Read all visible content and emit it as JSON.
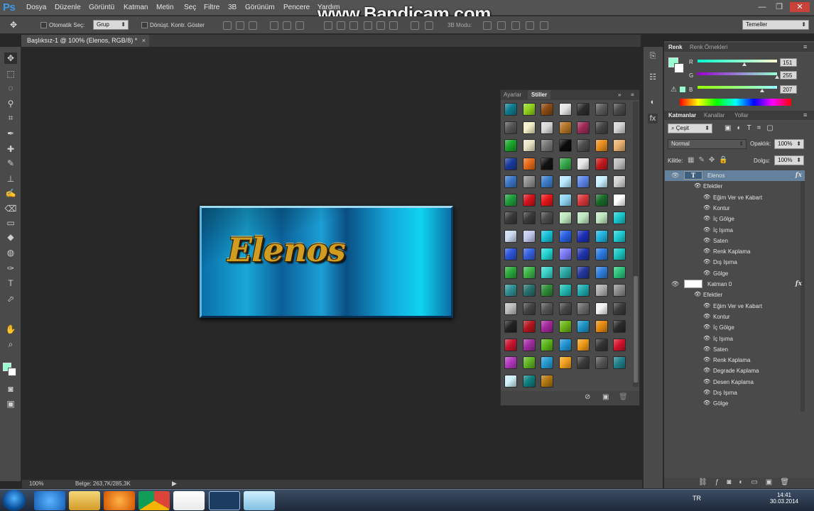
{
  "app": {
    "logo": "Ps",
    "watermark": "www.Bandicam.com"
  },
  "menu": [
    "Dosya",
    "Düzenle",
    "Görüntü",
    "Katman",
    "Metin",
    "Seç",
    "Filtre",
    "3B",
    "Görünüm",
    "Pencere",
    "Yardım"
  ],
  "window_controls": {
    "minimize": "—",
    "restore": "❐",
    "close": "✕"
  },
  "options": {
    "auto_select_label": "Otomatik Seç:",
    "auto_select_value": "Grup",
    "transform_label": "Dönüşt. Kontr. Göster",
    "mode3d_label": "3B Modu:",
    "workspace_value": "Temeller"
  },
  "document": {
    "tab_title": "Başlıksız-1 @ 100% (Elenos, RGB/8) *",
    "close": "×",
    "text": "Elenos"
  },
  "statusbar": {
    "zoom": "100%",
    "doc_info": "Belge: 263,7K/285,3K"
  },
  "styles_panel": {
    "tabs": [
      "Ayarlar",
      "Stiller"
    ],
    "swatches": [
      "#0d7b8e",
      "#8fd11c",
      "#8a4a12",
      "#e4e4e4",
      "#2c2c2c",
      "#5a5a5a",
      "#4a4a4a",
      "#555555",
      "#f3f0c6",
      "#d8d8d8",
      "#b27428",
      "#9e2a56",
      "#444444",
      "#d3d3d3",
      "#19a32a",
      "#e9e3c4",
      "#777777",
      "#0b0b0b",
      "#4d4d4d",
      "#e88d1d",
      "#e7b070",
      "#1a3a9c",
      "#e86a17",
      "#111111",
      "#36a84a",
      "#e8e8e8",
      "#c1191b",
      "#bdbdbd",
      "#3b75c5",
      "#8f8f8f",
      "#3d7dc8",
      "#b8e8ff",
      "#5d84e8",
      "#c8f0ff",
      "#d0d0d0",
      "#1e9c3a",
      "#d4131a",
      "#e41518",
      "#8fd4f0",
      "#d6363b",
      "#186a28",
      "#ffffff",
      "#3a3a3a",
      "#3a3a3a",
      "#4a4a4a",
      "#bfe7bf",
      "#bfe7c2",
      "#bfe7c0",
      "#19c7cc",
      "#cbd9ef",
      "#c0c8ee",
      "#19c0d7",
      "#2a5fe0",
      "#1c2fb7",
      "#20b3df",
      "#1ecad2",
      "#2c53d8",
      "#3560e0",
      "#24d4d0",
      "#7c79f5",
      "#2034b0",
      "#2b7adf",
      "#1bc5c0",
      "#2aa93a",
      "#3cb548",
      "#3bd1c8",
      "#2ca8a8",
      "#22379e",
      "#2f7edc",
      "#2dc27a",
      "#2e8f93",
      "#26706e",
      "#2f8a36",
      "#22b8b0",
      "#1da9ae",
      "#adadad",
      "#8c8c8c",
      "#bdbdbd",
      "#444444",
      "#555555",
      "#484848",
      "#6a6a6a",
      "#f2f2f2",
      "#3b3b3b",
      "#222222",
      "#b3161c",
      "#a4289b",
      "#6bb319",
      "#1d94c7",
      "#e6890f",
      "#2a2a2a",
      "#c8142f",
      "#a12ca0",
      "#5bb51b",
      "#2395d2",
      "#ee9a16",
      "#333333",
      "#d3132d",
      "#b338bf",
      "#5fb521",
      "#259ad0",
      "#f0a020",
      "#3b3b3b",
      "#555555",
      "#20808a",
      "#cfeff8",
      "#0e7f80",
      "#b27711"
    ],
    "footer_icons": [
      "no-icon",
      "new-icon",
      "trash-icon"
    ]
  },
  "color_panel": {
    "tabs": [
      "Renk",
      "Renk Örnekleri"
    ],
    "r": 151,
    "g": 255,
    "b": 207,
    "labels": [
      "R",
      "G",
      "B"
    ],
    "foreground": "#97ffcf"
  },
  "layers_panel": {
    "tabs": [
      "Katmanlar",
      "Kanallar",
      "Yollar"
    ],
    "filter_value": "Çeşit",
    "blend_mode": "Normal",
    "opacity_label": "Opaklık:",
    "opacity_value": "100%",
    "lock_label": "Kilitle:",
    "fill_label": "Dolgu:",
    "fill_value": "100%",
    "layers": [
      {
        "name": "Elenos",
        "type": "text",
        "thumb_glyph": "T",
        "effects_label": "Efektler",
        "effects": [
          "Eğim Ver ve Kabart",
          "Kontur",
          "İç Gölge",
          "İç Işıma",
          "Saten",
          "Renk Kaplama",
          "Dış Işıma",
          "Gölge"
        ]
      },
      {
        "name": "Katman 0",
        "type": "pixel",
        "thumb_glyph": "",
        "effects_label": "Efektler",
        "effects": [
          "Eğim Ver ve Kabart",
          "Kontur",
          "İç Gölge",
          "İç Işıma",
          "Saten",
          "Renk Kaplama",
          "Degrade Kaplama",
          "Desen Kaplama",
          "Dış Işıma",
          "Gölge"
        ]
      }
    ],
    "fx_glyph": "fx"
  },
  "taskbar": {
    "lang": "TR",
    "time": "14:41",
    "date": "30.03.2014"
  }
}
